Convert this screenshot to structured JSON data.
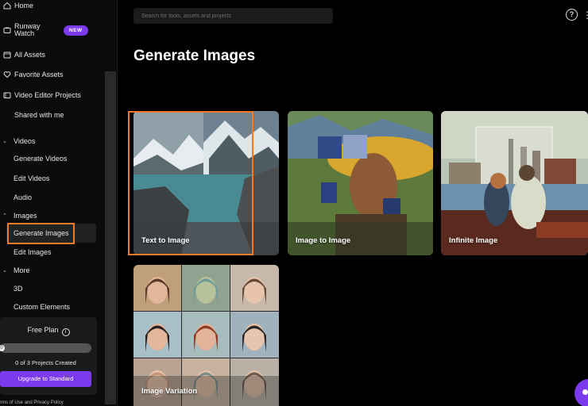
{
  "sidebar": {
    "home_label": "Home",
    "runway_watch_label": "Runway Watch",
    "new_badge": "NEW",
    "items": [
      {
        "label": "All Assets"
      },
      {
        "label": "Favorite Assets"
      },
      {
        "label": "Video Editor Projects"
      },
      {
        "label": "Shared with me"
      }
    ],
    "sections": [
      {
        "label": "Videos",
        "items": [
          "Generate Videos",
          "Edit Videos",
          "Audio"
        ]
      },
      {
        "label": "Images",
        "items": [
          "Generate Images",
          "Edit Images"
        ]
      },
      {
        "label": "More",
        "items": [
          "3D",
          "Custom Elements"
        ]
      }
    ],
    "active_item": "Generate Images",
    "plan": {
      "title": "Free Plan",
      "progress_value": 0,
      "progress_label": "0",
      "projects_text": "0 of 3 Projects Created",
      "upgrade_label": "Upgrade to Standard"
    },
    "footer": {
      "terms": "rms of Use",
      "and": "and",
      "privacy": "Privacy Policy"
    }
  },
  "header": {
    "search_placeholder": "Search for tools, assets and projects"
  },
  "main": {
    "title": "Generate Images",
    "cards": [
      {
        "label": "Text to Image",
        "highlighted": true
      },
      {
        "label": "Image to Image"
      },
      {
        "label": "Infinite Image"
      },
      {
        "label": "Image Variation"
      }
    ]
  },
  "colors": {
    "accent": "#7c3aed",
    "highlight": "#f07a2a",
    "background": "#000000"
  }
}
